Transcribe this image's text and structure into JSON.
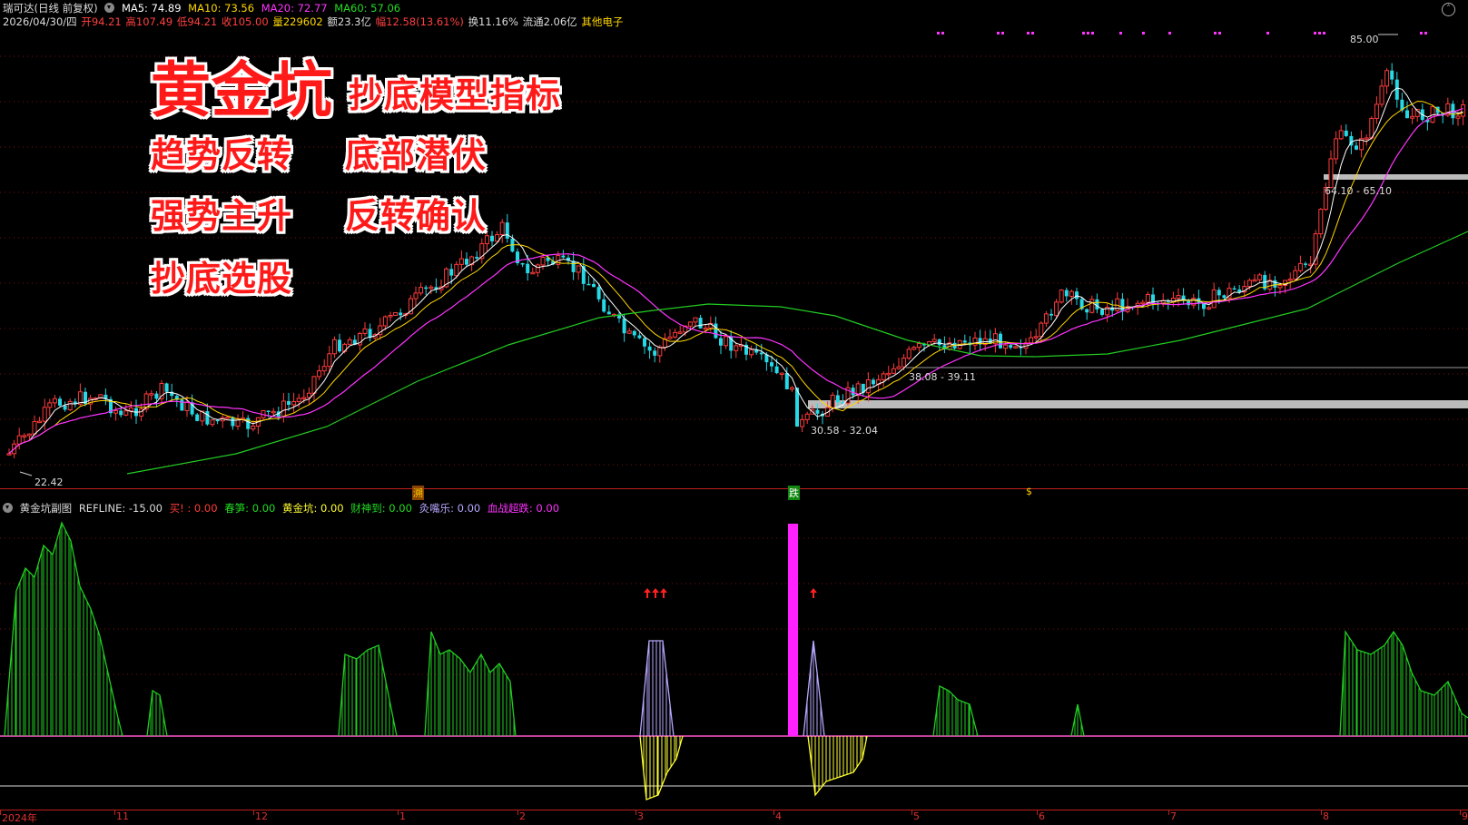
{
  "header1": {
    "name": "瑞可达(日线 前复权)",
    "ma5": "MA5: 74.89",
    "ma10": "MA10: 73.56",
    "ma20": "MA20: 72.77",
    "ma60": "MA60: 57.06"
  },
  "header2": {
    "date": "2026/04/30/四",
    "open": "开94.21",
    "high": "高107.49",
    "low": "低94.21",
    "close": "收105.00",
    "vol": "量229602",
    "amount": "额23.3亿",
    "change": "幅12.58(13.61%)",
    "turnover": "换11.16%",
    "float": "流通2.06亿",
    "sector": "其他电子"
  },
  "promo": {
    "big": "黄金坑",
    "l1": "抄底模型指标",
    "l2a": "趋势反转",
    "l2b": "底部潜伏",
    "l3a": "强势主升",
    "l3b": "反转确认",
    "l4": "抄底选股"
  },
  "price_labels": {
    "high": "85.00",
    "low": "22.42",
    "zone1": "64.10 - 65.10",
    "zone2": "38.08 - 39.11",
    "zone3": "30.58 - 32.04"
  },
  "event_marks": {
    "e1": "溯",
    "e2": "跌",
    "e3": "$"
  },
  "sub_header": {
    "name": "黄金坑副图",
    "refline": "REFLINE: -15.00",
    "buy": "买!",
    "buy_val": ": 0.00",
    "chunsun": "春笋: 0.00",
    "hjk": "黄金坑: 0.00",
    "cai": "财神到: 0.00",
    "an": "灸嘴乐: 0.00",
    "xue": "血战超跌: 0.00"
  },
  "x_labels": [
    "2024年",
    "11",
    "12",
    "1",
    "2",
    "3",
    "4",
    "5",
    "6",
    "7",
    "8",
    "9"
  ],
  "colors": {
    "up": "#ff3b3b",
    "down": "#25d9e6",
    "ma5": "#ffffff",
    "ma10": "#ffd700",
    "ma20": "#ff33ff",
    "ma60": "#22cc22",
    "green": "#22cc22",
    "pink": "#ff55cc",
    "lav": "#b8a8ff",
    "yel": "#ffff33"
  }
}
